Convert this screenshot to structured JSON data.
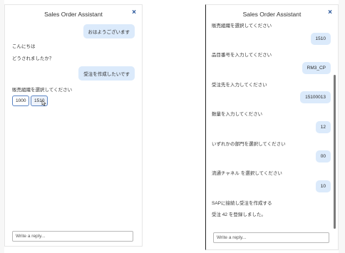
{
  "left": {
    "title": "Sales Order Assistant",
    "close_label": "×",
    "user_msg_1": "おはようございます",
    "bot_msg_1": "こんにちは",
    "bot_msg_2": "どうされましたか？",
    "user_msg_2": "受注を作成したいです",
    "bot_msg_3": "販売組織を選択してください",
    "options": [
      "1000",
      "1510"
    ],
    "reply_placeholder": "Write a reply..."
  },
  "right": {
    "title": "Sales Order Assistant",
    "close_label": "×",
    "messages": [
      {
        "bot": "販売組織を選択してください",
        "user": "1510"
      },
      {
        "bot": "品目番号を入力してください",
        "user": "RM3_CP"
      },
      {
        "bot": "受注先を入力してください",
        "user": "15100013"
      },
      {
        "bot": "数量を入力してください",
        "user": "12"
      },
      {
        "bot": "いずれかの部門を選択してください",
        "user": "00"
      },
      {
        "bot": "流通チャネル を選択してください",
        "user": "10"
      }
    ],
    "final_1": "SAPに接続し受注を作成する",
    "final_2": "受注 42 を登録しました。",
    "reply_placeholder": "Write a reply..."
  }
}
